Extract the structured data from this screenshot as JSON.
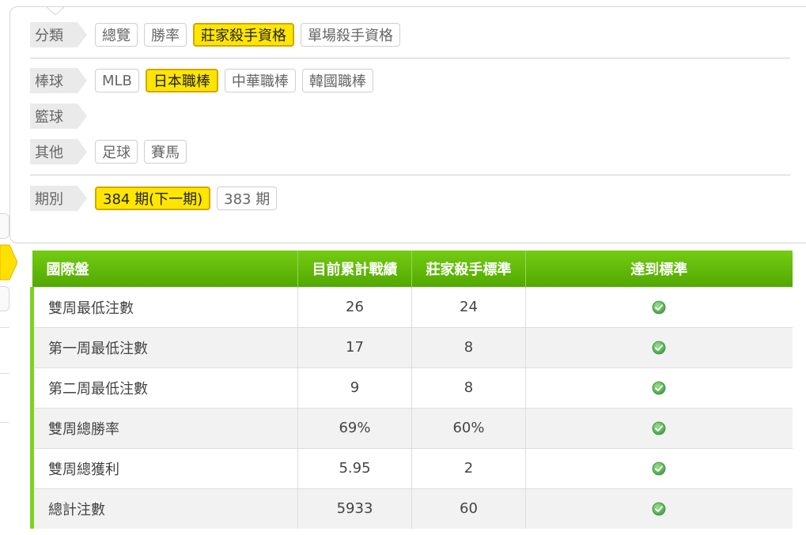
{
  "filters": {
    "category": {
      "label": "分類",
      "options": [
        {
          "label": "總覽",
          "active": false
        },
        {
          "label": "勝率",
          "active": false
        },
        {
          "label": "莊家殺手資格",
          "active": true
        },
        {
          "label": "單場殺手資格",
          "active": false
        }
      ]
    },
    "baseball": {
      "label": "棒球",
      "options": [
        {
          "label": "MLB",
          "active": false
        },
        {
          "label": "日本職棒",
          "active": true
        },
        {
          "label": "中華職棒",
          "active": false
        },
        {
          "label": "韓國職棒",
          "active": false
        }
      ]
    },
    "basketball": {
      "label": "籃球"
    },
    "other": {
      "label": "其他",
      "options": [
        {
          "label": "足球",
          "active": false
        },
        {
          "label": "賽馬",
          "active": false
        }
      ]
    },
    "period": {
      "label": "期別",
      "options": [
        {
          "label": "384 期(下一期)",
          "active": true
        },
        {
          "label": "383 期",
          "active": false
        }
      ]
    }
  },
  "table": {
    "headers": [
      "國際盤",
      "目前累計戰績",
      "莊家殺手標準",
      "達到標準"
    ],
    "rows": [
      {
        "name": "雙周最低注數",
        "current": "26",
        "standard": "24",
        "met": true
      },
      {
        "name": "第一周最低注數",
        "current": "17",
        "standard": "8",
        "met": true
      },
      {
        "name": "第二周最低注數",
        "current": "9",
        "standard": "8",
        "met": true
      },
      {
        "name": "雙周總勝率",
        "current": "69%",
        "standard": "60%",
        "met": true
      },
      {
        "name": "雙周總獲利",
        "current": "5.95",
        "standard": "2",
        "met": true
      },
      {
        "name": "總計注數",
        "current": "5933",
        "standard": "60",
        "met": true
      }
    ]
  },
  "colors": {
    "accent_yellow": "#ffe600",
    "header_green": "#5fb80a",
    "row_accent_green": "#7ed321",
    "check_green": "#5cb85c"
  }
}
